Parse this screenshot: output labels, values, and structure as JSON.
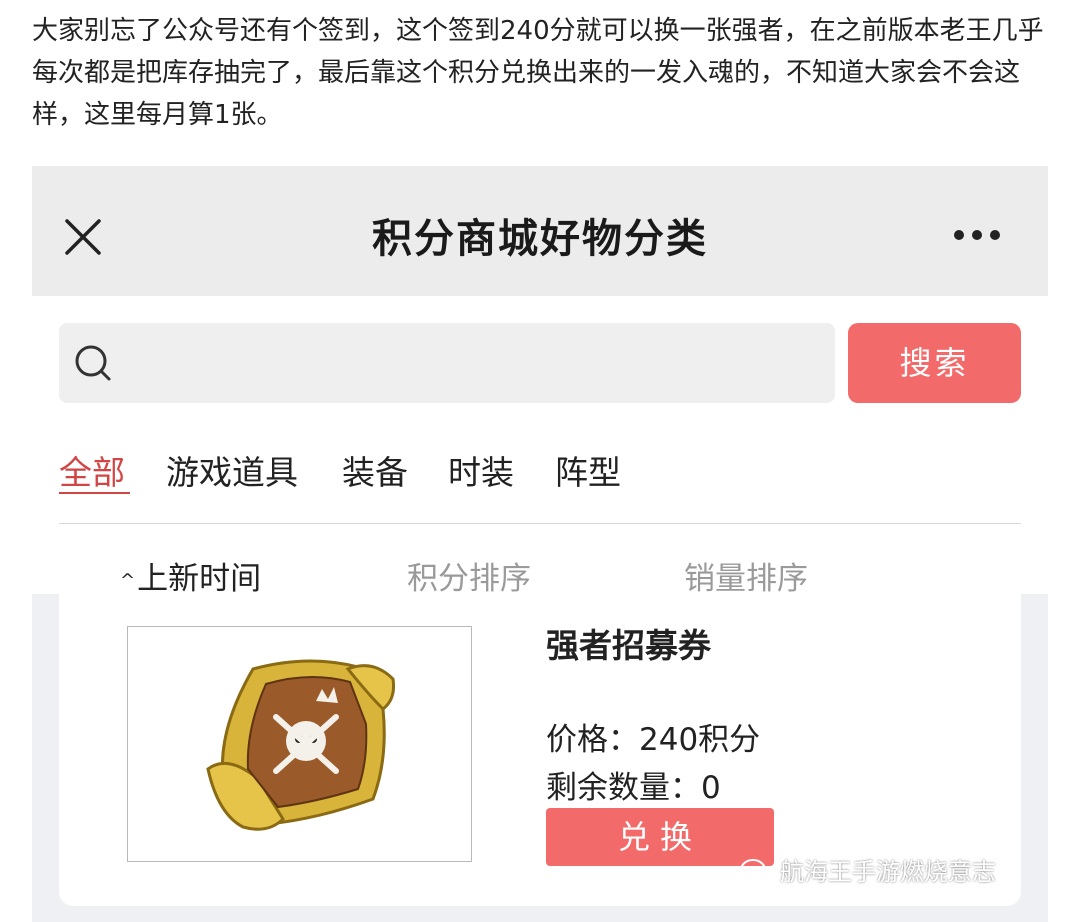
{
  "article": {
    "paragraph": "大家别忘了公众号还有个签到，这个签到240分就可以换一张强者，在之前版本老王几乎每次都是把库存抽完了，最后靠这个积分兑换出来的一发入魂的，不知道大家会不会这样，这里每月算1张。"
  },
  "nav": {
    "title": "积分商城好物分类",
    "close_icon": "close-icon",
    "more_icon": "more-icon"
  },
  "search": {
    "placeholder": "",
    "value": "",
    "button_label": "搜索"
  },
  "tabs": [
    {
      "label": "全部",
      "active": true
    },
    {
      "label": "游戏道具",
      "active": false
    },
    {
      "label": "装备",
      "active": false
    },
    {
      "label": "时装",
      "active": false
    },
    {
      "label": "阵型",
      "active": false
    }
  ],
  "sort": {
    "new": {
      "label": "上新时间",
      "active": true,
      "icon": "caret-up-icon"
    },
    "points": {
      "label": "积分排序",
      "active": false
    },
    "sales": {
      "label": "销量排序",
      "active": false
    }
  },
  "product": {
    "name": "强者招募券",
    "price": "价格：240积分",
    "stock": "剩余数量：0",
    "redeem_label": "兑换",
    "image_icon": "pirate-scroll-icon"
  },
  "watermark": {
    "text": "航海王手游燃烧意志",
    "icon": "wechat-icon"
  },
  "colors": {
    "accent": "#f36a6a",
    "active_tab": "#d24545",
    "nav_bg": "#ececec"
  }
}
